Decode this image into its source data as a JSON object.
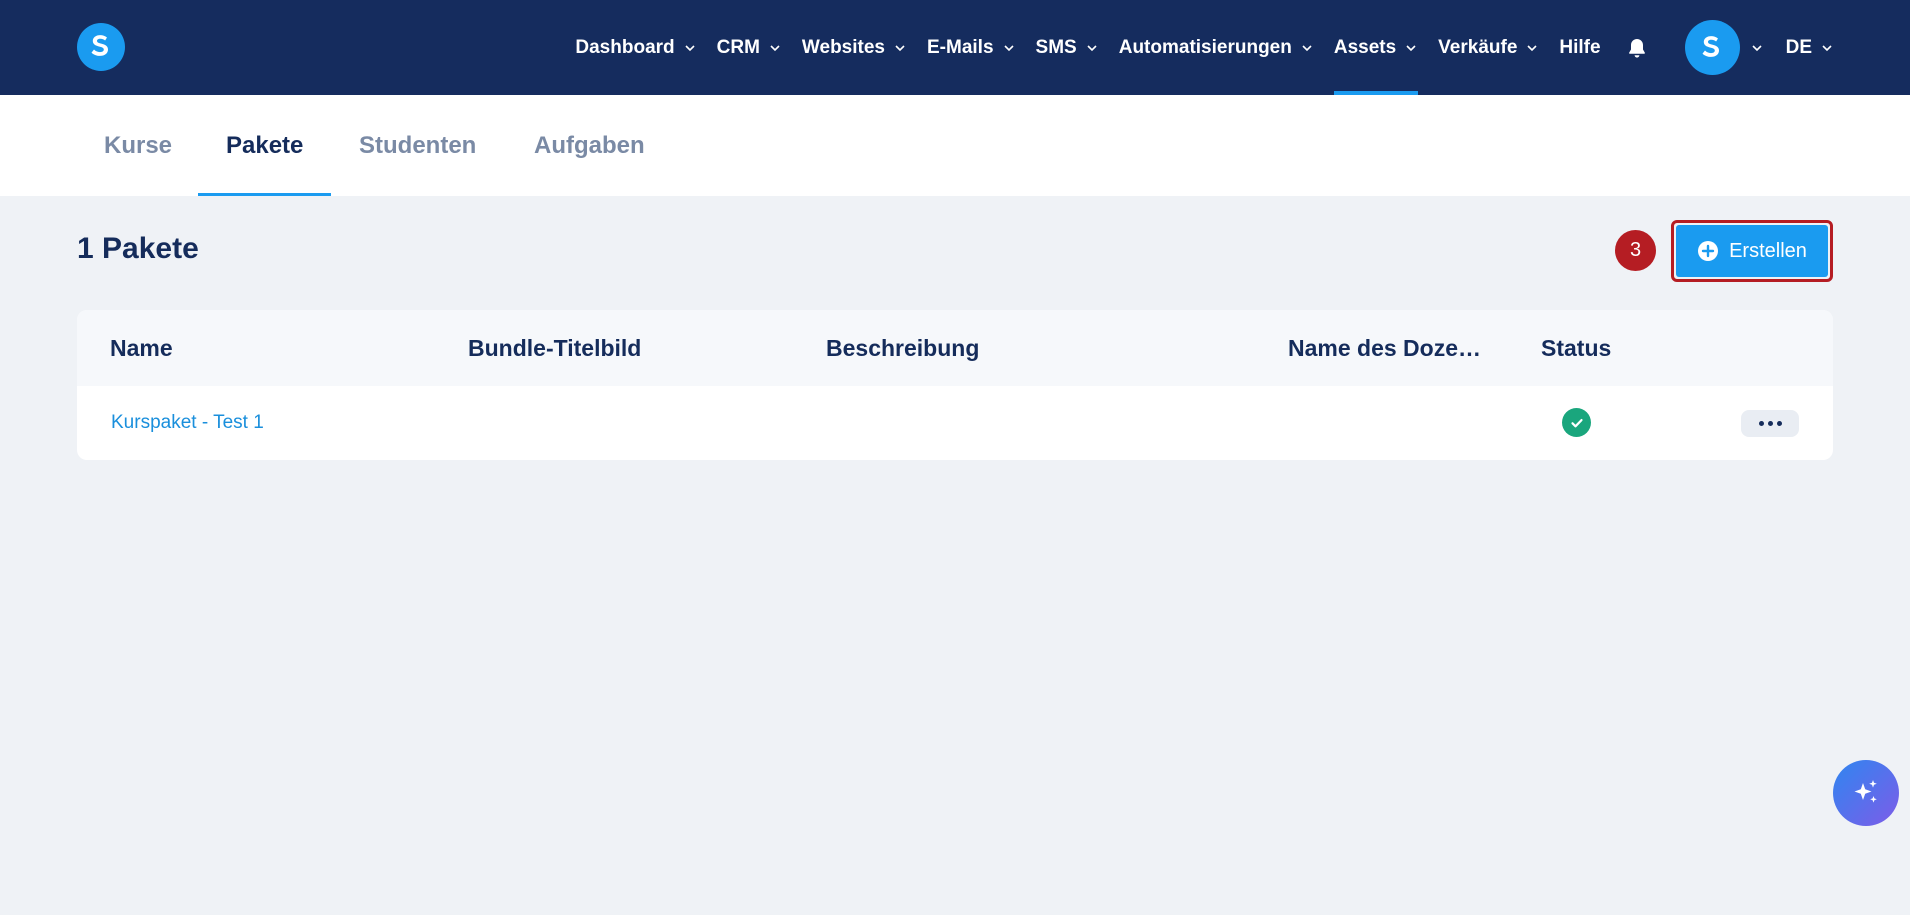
{
  "nav": {
    "items": [
      {
        "label": "Dashboard",
        "dropdown": true,
        "active": false
      },
      {
        "label": "CRM",
        "dropdown": true,
        "active": false
      },
      {
        "label": "Websites",
        "dropdown": true,
        "active": false
      },
      {
        "label": "E-Mails",
        "dropdown": true,
        "active": false
      },
      {
        "label": "SMS",
        "dropdown": true,
        "active": false
      },
      {
        "label": "Automatisierungen",
        "dropdown": true,
        "active": false
      },
      {
        "label": "Assets",
        "dropdown": true,
        "active": true
      },
      {
        "label": "Verkäufe",
        "dropdown": true,
        "active": false
      },
      {
        "label": "Hilfe",
        "dropdown": false,
        "active": false
      }
    ],
    "bell_icon": "bell-icon",
    "language": "DE"
  },
  "tabs": [
    {
      "label": "Kurse",
      "active": false
    },
    {
      "label": "Pakete",
      "active": true
    },
    {
      "label": "Studenten",
      "active": false
    },
    {
      "label": "Aufgaben",
      "active": false
    }
  ],
  "page": {
    "title": "1 Pakete",
    "step_badge": "3",
    "create_label": "Erstellen"
  },
  "table": {
    "columns": [
      "Name",
      "Bundle-Titelbild",
      "Beschreibung",
      "Name des Doze…",
      "Status"
    ],
    "rows": [
      {
        "name": "Kurspaket - Test 1",
        "status": "active"
      }
    ]
  },
  "colors": {
    "nav_bg": "#152c5e",
    "accent": "#1a9bf0",
    "highlight": "#b51d23",
    "status_ok": "#1aa67d"
  }
}
